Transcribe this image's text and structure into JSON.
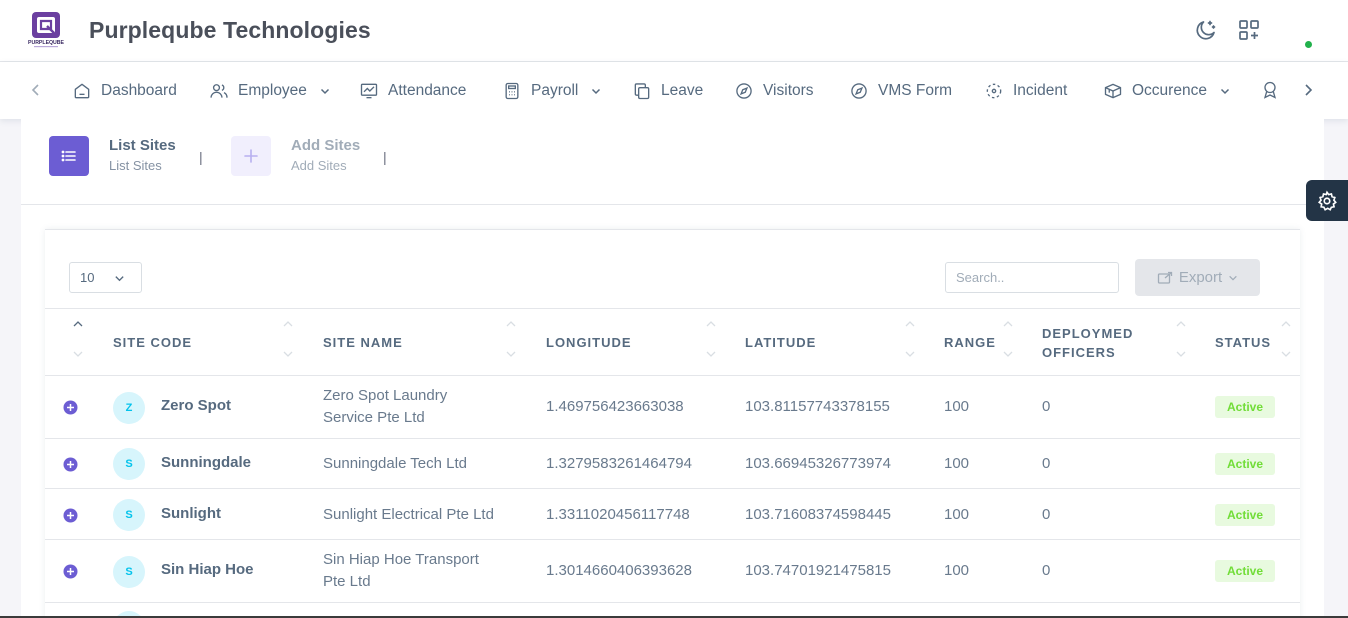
{
  "header": {
    "brand": "Purpleqube Technologies",
    "logo_text": "PURPLEQUBE",
    "icons": [
      "moon-icon",
      "apps-add-icon"
    ],
    "online_color": "#22b14c"
  },
  "nav": {
    "items": [
      {
        "label": "Dashboard",
        "icon": "home-icon"
      },
      {
        "label": "Employee",
        "icon": "users-icon",
        "dropdown": true
      },
      {
        "label": "Attendance",
        "icon": "chart-icon"
      },
      {
        "label": "Payroll",
        "icon": "calculator-icon",
        "dropdown": true
      },
      {
        "label": "Leave",
        "icon": "copy-icon"
      },
      {
        "label": "Visitors",
        "icon": "compass-icon"
      },
      {
        "label": "VMS Form",
        "icon": "compass-icon"
      },
      {
        "label": "Incident",
        "icon": "focus-icon"
      },
      {
        "label": "Occurence",
        "icon": "boxes-icon",
        "dropdown": true
      }
    ]
  },
  "tabs": [
    {
      "title": "List Sites",
      "subtitle": "List Sites",
      "active": true
    },
    {
      "title": "Add Sites",
      "subtitle": "Add Sites",
      "active": false
    }
  ],
  "toolbar": {
    "page_size": "10",
    "search_placeholder": "Search..",
    "export_label": "Export"
  },
  "table": {
    "columns": [
      "SITE CODE",
      "SITE NAME",
      "LONGITUDE",
      "LATITUDE",
      "RANGE",
      "DEPLOYMED OFFICERS",
      "STATUS"
    ],
    "rows": [
      {
        "initial": "Z",
        "code": "Zero Spot",
        "name": "Zero Spot Laundry Service Pte Ltd",
        "longitude": "1.469756423663038",
        "latitude": "103.81157743378155",
        "range": "100",
        "officers": "0",
        "status": "Active"
      },
      {
        "initial": "S",
        "code": "Sunningdale",
        "name": "Sunningdale Tech Ltd",
        "longitude": "1.3279583261464794",
        "latitude": "103.66945326773974",
        "range": "100",
        "officers": "0",
        "status": "Active"
      },
      {
        "initial": "S",
        "code": "Sunlight",
        "name": "Sunlight Electrical Pte Ltd",
        "longitude": "1.3311020456117748",
        "latitude": "103.71608374598445",
        "range": "100",
        "officers": "0",
        "status": "Active"
      },
      {
        "initial": "S",
        "code": "Sin Hiap Hoe",
        "name": "Sin Hiap Hoe Transport Pte Ltd",
        "longitude": "1.3014660406393628",
        "latitude": "103.74701921475815",
        "range": "100",
        "officers": "0",
        "status": "Active"
      }
    ]
  },
  "colors": {
    "primary": "#6c5dd3",
    "active_badge_bg": "#e8fadf",
    "active_badge_text": "#71dd37",
    "avatar_bg": "#d7f5fc",
    "avatar_text": "#03c3ec"
  }
}
